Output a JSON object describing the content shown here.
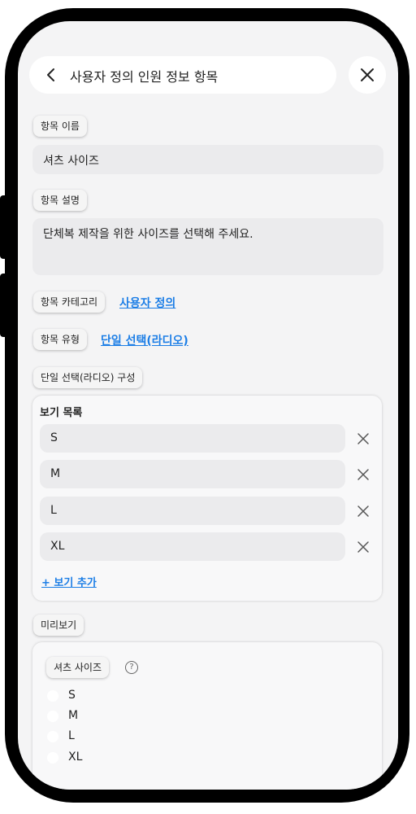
{
  "header": {
    "title": "사용자 정의 인원 정보 항목"
  },
  "name_section": {
    "label": "항목 이름",
    "value": "셔츠 사이즈"
  },
  "desc_section": {
    "label": "항목 설명",
    "value": "단체복 제작을 위한 사이즈를 선택해 주세요."
  },
  "category_section": {
    "label": "항목 카테고리",
    "value": "사용자 정의"
  },
  "type_section": {
    "label": "항목 유형",
    "value": "단일 선택(라디오)"
  },
  "config_section": {
    "label": "단일 선택(라디오) 구성",
    "options_title": "보기 목록",
    "options": [
      "S",
      "M",
      "L",
      "XL"
    ],
    "add_option": "+ 보기 추가"
  },
  "preview_section": {
    "label": "미리보기",
    "field_label": "셔츠 사이즈",
    "help_icon": "?",
    "options": [
      "S",
      "M",
      "L",
      "XL"
    ]
  }
}
